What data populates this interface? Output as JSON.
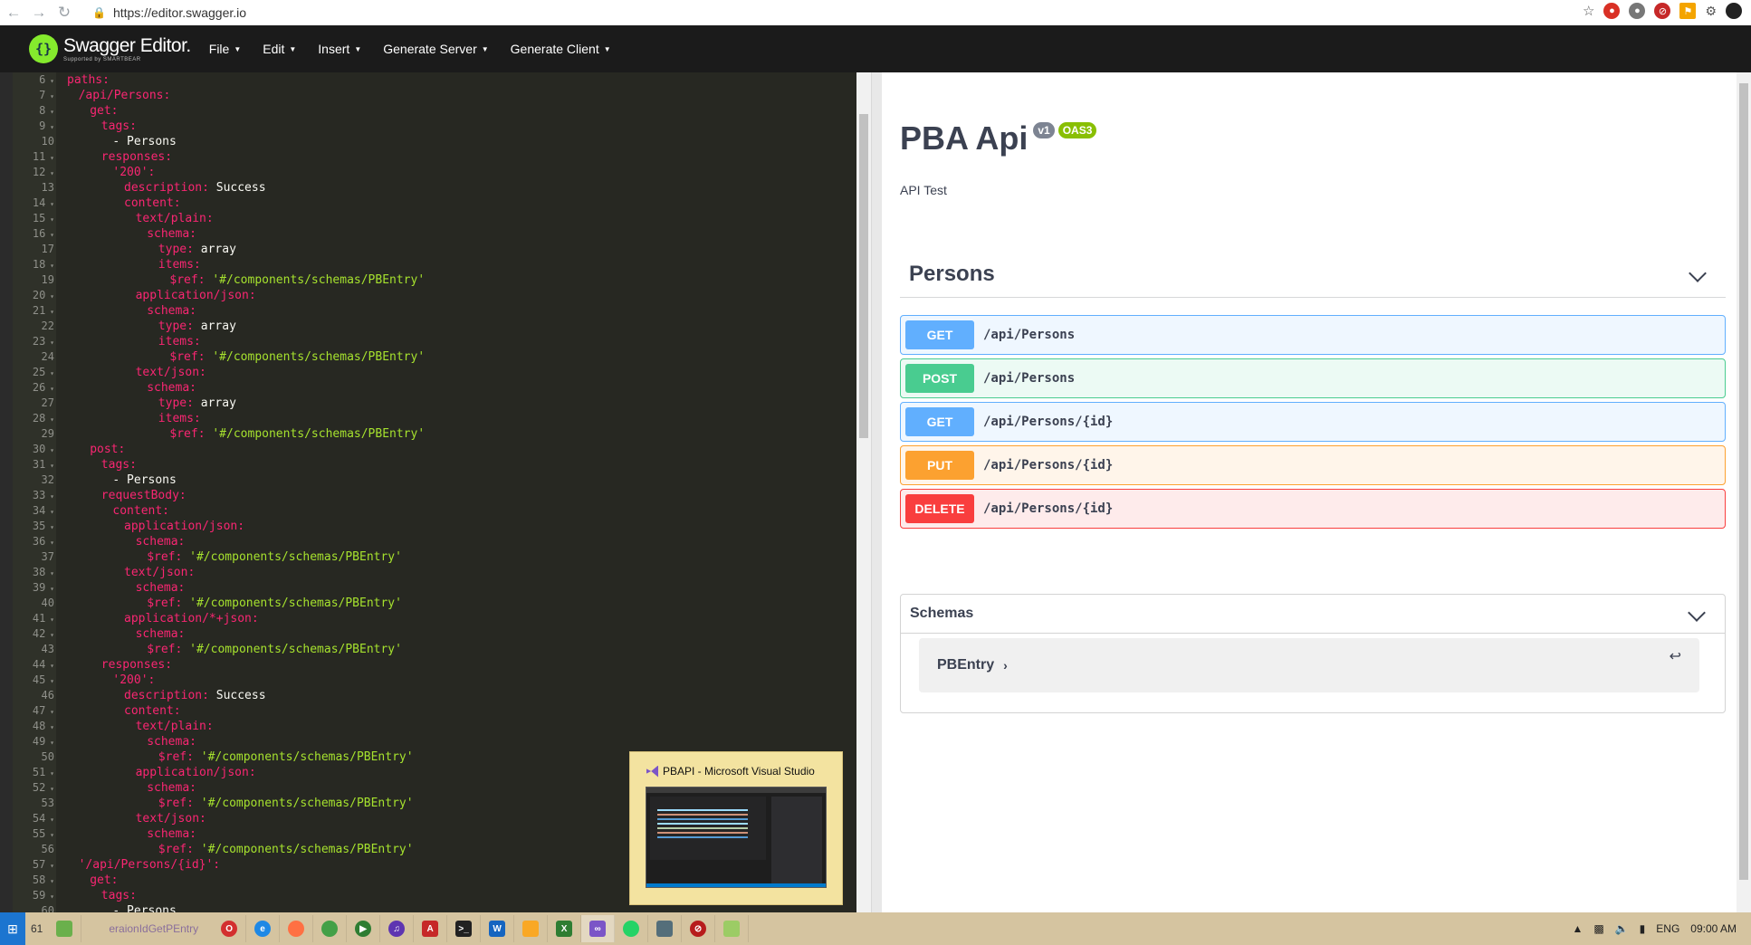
{
  "browser": {
    "url": "https://editor.swagger.io",
    "back_icon": "arrow-left-icon",
    "forward_icon": "arrow-right-icon",
    "reload_icon": "reload-icon"
  },
  "topbar": {
    "logo_title": "Swagger Editor.",
    "logo_subtitle": "Supported by SMARTBEAR",
    "menu": [
      "File",
      "Edit",
      "Insert",
      "Generate Server",
      "Generate Client"
    ]
  },
  "editor": {
    "lines": [
      {
        "n": "6",
        "fold": true,
        "indent": 0,
        "key": "paths:",
        "val": ""
      },
      {
        "n": "7",
        "fold": true,
        "indent": 1,
        "key": "/api/Persons:",
        "val": ""
      },
      {
        "n": "8",
        "fold": true,
        "indent": 2,
        "key": "get:",
        "val": ""
      },
      {
        "n": "9",
        "fold": true,
        "indent": 3,
        "key": "tags:",
        "val": ""
      },
      {
        "n": "10",
        "fold": false,
        "indent": 4,
        "key": "",
        "val": "- Persons"
      },
      {
        "n": "11",
        "fold": true,
        "indent": 3,
        "key": "responses:",
        "val": ""
      },
      {
        "n": "12",
        "fold": true,
        "indent": 4,
        "key": "'200':",
        "val": ""
      },
      {
        "n": "13",
        "fold": false,
        "indent": 5,
        "key": "description:",
        "val": " Success"
      },
      {
        "n": "14",
        "fold": true,
        "indent": 5,
        "key": "content:",
        "val": ""
      },
      {
        "n": "15",
        "fold": true,
        "indent": 6,
        "key": "text/plain:",
        "val": ""
      },
      {
        "n": "16",
        "fold": true,
        "indent": 7,
        "key": "schema:",
        "val": ""
      },
      {
        "n": "17",
        "fold": false,
        "indent": 8,
        "key": "type:",
        "val": " array"
      },
      {
        "n": "18",
        "fold": true,
        "indent": 8,
        "key": "items:",
        "val": ""
      },
      {
        "n": "19",
        "fold": false,
        "indent": 9,
        "key": "$ref:",
        "val": " '#/components/schemas/PBEntry'",
        "str": true
      },
      {
        "n": "20",
        "fold": true,
        "indent": 6,
        "key": "application/json:",
        "val": ""
      },
      {
        "n": "21",
        "fold": true,
        "indent": 7,
        "key": "schema:",
        "val": ""
      },
      {
        "n": "22",
        "fold": false,
        "indent": 8,
        "key": "type:",
        "val": " array"
      },
      {
        "n": "23",
        "fold": true,
        "indent": 8,
        "key": "items:",
        "val": ""
      },
      {
        "n": "24",
        "fold": false,
        "indent": 9,
        "key": "$ref:",
        "val": " '#/components/schemas/PBEntry'",
        "str": true
      },
      {
        "n": "25",
        "fold": true,
        "indent": 6,
        "key": "text/json:",
        "val": ""
      },
      {
        "n": "26",
        "fold": true,
        "indent": 7,
        "key": "schema:",
        "val": ""
      },
      {
        "n": "27",
        "fold": false,
        "indent": 8,
        "key": "type:",
        "val": " array"
      },
      {
        "n": "28",
        "fold": true,
        "indent": 8,
        "key": "items:",
        "val": ""
      },
      {
        "n": "29",
        "fold": false,
        "indent": 9,
        "key": "$ref:",
        "val": " '#/components/schemas/PBEntry'",
        "str": true
      },
      {
        "n": "30",
        "fold": true,
        "indent": 2,
        "key": "post:",
        "val": ""
      },
      {
        "n": "31",
        "fold": true,
        "indent": 3,
        "key": "tags:",
        "val": ""
      },
      {
        "n": "32",
        "fold": false,
        "indent": 4,
        "key": "",
        "val": "- Persons"
      },
      {
        "n": "33",
        "fold": true,
        "indent": 3,
        "key": "requestBody:",
        "val": ""
      },
      {
        "n": "34",
        "fold": true,
        "indent": 4,
        "key": "content:",
        "val": ""
      },
      {
        "n": "35",
        "fold": true,
        "indent": 5,
        "key": "application/json:",
        "val": ""
      },
      {
        "n": "36",
        "fold": true,
        "indent": 6,
        "key": "schema:",
        "val": ""
      },
      {
        "n": "37",
        "fold": false,
        "indent": 7,
        "key": "$ref:",
        "val": " '#/components/schemas/PBEntry'",
        "str": true
      },
      {
        "n": "38",
        "fold": true,
        "indent": 5,
        "key": "text/json:",
        "val": ""
      },
      {
        "n": "39",
        "fold": true,
        "indent": 6,
        "key": "schema:",
        "val": ""
      },
      {
        "n": "40",
        "fold": false,
        "indent": 7,
        "key": "$ref:",
        "val": " '#/components/schemas/PBEntry'",
        "str": true
      },
      {
        "n": "41",
        "fold": true,
        "indent": 5,
        "key": "application/*+json:",
        "val": ""
      },
      {
        "n": "42",
        "fold": true,
        "indent": 6,
        "key": "schema:",
        "val": ""
      },
      {
        "n": "43",
        "fold": false,
        "indent": 7,
        "key": "$ref:",
        "val": " '#/components/schemas/PBEntry'",
        "str": true
      },
      {
        "n": "44",
        "fold": true,
        "indent": 3,
        "key": "responses:",
        "val": ""
      },
      {
        "n": "45",
        "fold": true,
        "indent": 4,
        "key": "'200':",
        "val": ""
      },
      {
        "n": "46",
        "fold": false,
        "indent": 5,
        "key": "description:",
        "val": " Success"
      },
      {
        "n": "47",
        "fold": true,
        "indent": 5,
        "key": "content:",
        "val": ""
      },
      {
        "n": "48",
        "fold": true,
        "indent": 6,
        "key": "text/plain:",
        "val": ""
      },
      {
        "n": "49",
        "fold": true,
        "indent": 7,
        "key": "schema:",
        "val": ""
      },
      {
        "n": "50",
        "fold": false,
        "indent": 8,
        "key": "$ref:",
        "val": " '#/components/schemas/PBEntry'",
        "str": true
      },
      {
        "n": "51",
        "fold": true,
        "indent": 6,
        "key": "application/json:",
        "val": ""
      },
      {
        "n": "52",
        "fold": true,
        "indent": 7,
        "key": "schema:",
        "val": ""
      },
      {
        "n": "53",
        "fold": false,
        "indent": 8,
        "key": "$ref:",
        "val": " '#/components/schemas/PBEntry'",
        "str": true
      },
      {
        "n": "54",
        "fold": true,
        "indent": 6,
        "key": "text/json:",
        "val": ""
      },
      {
        "n": "55",
        "fold": true,
        "indent": 7,
        "key": "schema:",
        "val": ""
      },
      {
        "n": "56",
        "fold": false,
        "indent": 8,
        "key": "$ref:",
        "val": " '#/components/schemas/PBEntry'",
        "str": true
      },
      {
        "n": "57",
        "fold": true,
        "indent": 1,
        "key": "'/api/Persons/{id}':",
        "val": ""
      },
      {
        "n": "58",
        "fold": true,
        "indent": 2,
        "key": "get:",
        "val": ""
      },
      {
        "n": "59",
        "fold": true,
        "indent": 3,
        "key": "tags:",
        "val": ""
      },
      {
        "n": "60",
        "fold": false,
        "indent": 4,
        "key": "",
        "val": "- Persons"
      }
    ]
  },
  "preview": {
    "title": "PBA Api",
    "version_badge": "v1",
    "oas_badge": "OAS3",
    "description": "API Test",
    "tag": "Persons",
    "operations": [
      {
        "method": "GET",
        "path": "/api/Persons",
        "cls": "get"
      },
      {
        "method": "POST",
        "path": "/api/Persons",
        "cls": "post"
      },
      {
        "method": "GET",
        "path": "/api/Persons/{id}",
        "cls": "get"
      },
      {
        "method": "PUT",
        "path": "/api/Persons/{id}",
        "cls": "put"
      },
      {
        "method": "DELETE",
        "path": "/api/Persons/{id}",
        "cls": "delete"
      }
    ],
    "schemas_title": "Schemas",
    "model_name": "PBEntry"
  },
  "tooltip": {
    "title": "PBAPI - Microsoft Visual Studio"
  },
  "taskbar": {
    "count": "61",
    "ghost_text": "eraionIdGetPEntry",
    "language": "ENG",
    "time": "09:00 AM"
  }
}
